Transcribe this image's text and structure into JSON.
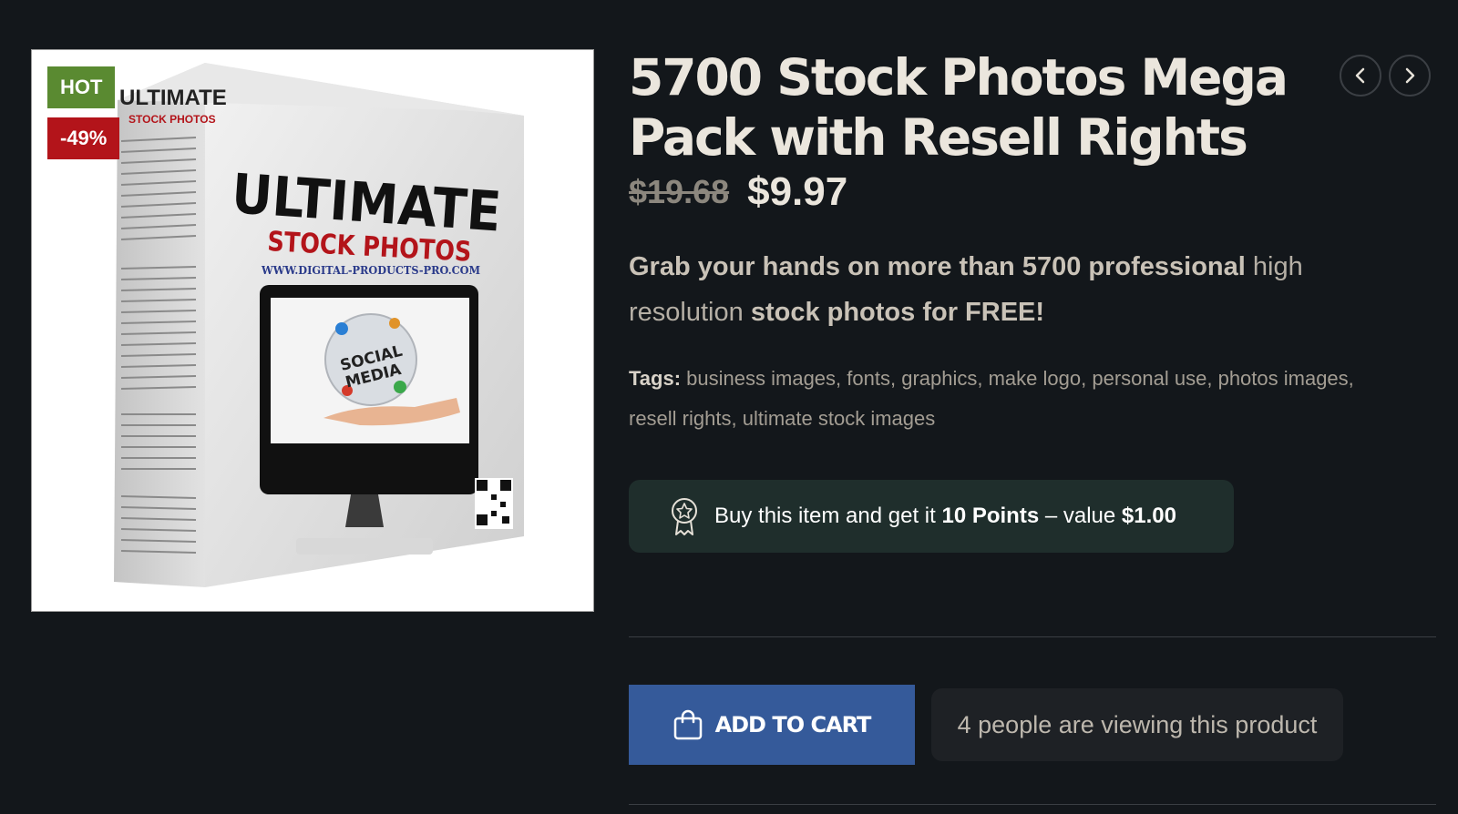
{
  "product": {
    "title": "5700 Stock Photos Mega Pack with Resell Rights",
    "price_old": "$19.68",
    "price_new": "$9.97",
    "badges": {
      "hot": "HOT",
      "discount": "-49%"
    },
    "image": {
      "box_title_1": "ULTIMATE",
      "box_title_2": "STOCK PHOTOS",
      "box_url": "WWW.DIGITAL-PRODUCTS-PRO.COM",
      "globe_text_1": "SOCIAL",
      "globe_text_2": "MEDIA",
      "spine_title_1": "ULTIMATE",
      "spine_title_2": "STOCK PHOTOS"
    }
  },
  "description": {
    "part1": "Grab your hands on more than 5700 professional",
    "part2": " high resolution ",
    "part3": "stock photos for FREE!"
  },
  "tags": {
    "label": "Tags:",
    "items": [
      "business images",
      "fonts",
      "graphics",
      "make logo",
      "personal use",
      "photos images",
      "resell rights",
      "ultimate stock images"
    ]
  },
  "points": {
    "text1": "Buy this item and get it ",
    "points": "10 Points",
    "text2": " – value ",
    "value": "$1.00"
  },
  "cart": {
    "label": "ADD TO CART"
  },
  "viewing": {
    "text": "4 people are viewing this product"
  },
  "icons": {
    "prev": "chevron-left-icon",
    "next": "chevron-right-icon",
    "cart": "shopping-bag-icon",
    "points": "award-badge-icon"
  },
  "colors": {
    "background": "#13171b",
    "hot": "#5a8a31",
    "discount": "#b3141a",
    "cart": "#355a9a",
    "points_bg": "#1f2e2c"
  }
}
